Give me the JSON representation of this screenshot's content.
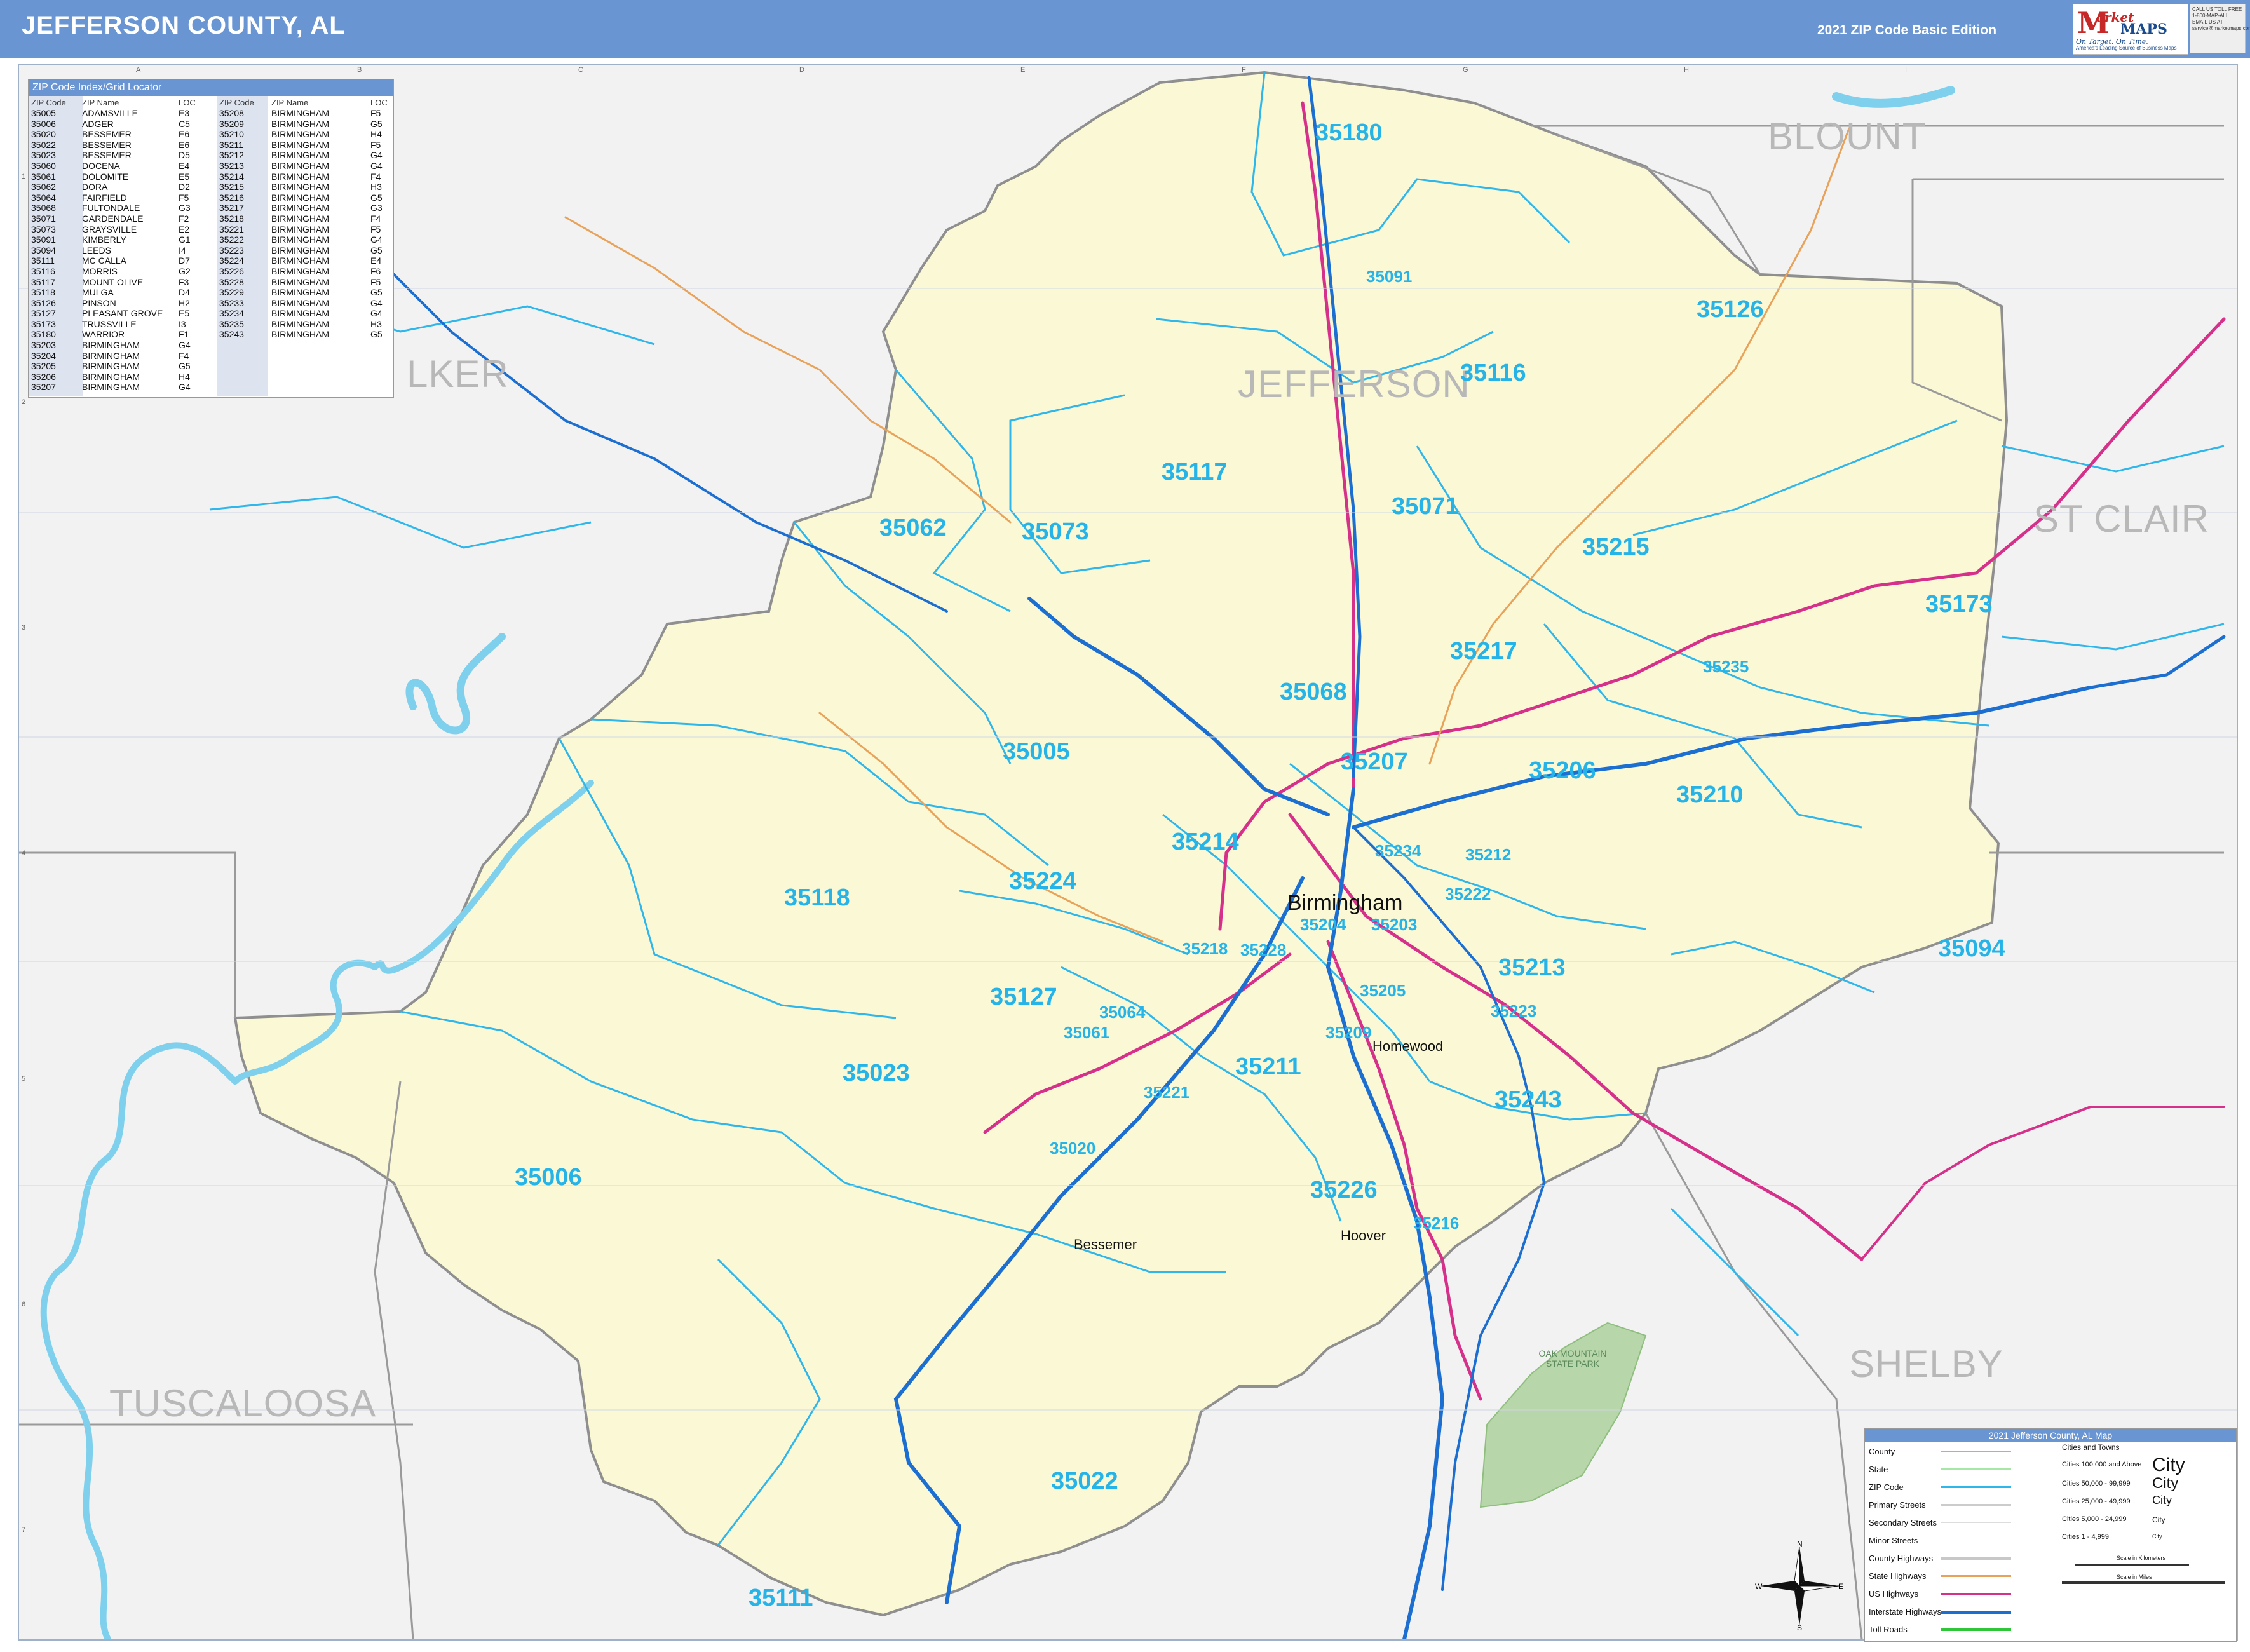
{
  "header": {
    "title": "JEFFERSON COUNTY, AL",
    "edition": "2021 ZIP Code Basic Edition",
    "logo": {
      "brand_letter": "M",
      "brand_top": "arket",
      "brand_bottom": "MAPS",
      "tagline": "On Target. On Time.",
      "tagline2": "America's Leading Source of Business Maps"
    },
    "contact_lines": [
      "CALL US TOLL FREE",
      "1-800-MAP-ALL",
      "EMAIL US AT",
      "service@marketmaps.com"
    ]
  },
  "grid": {
    "letters": [
      "A",
      "B",
      "C",
      "D",
      "E",
      "F",
      "G",
      "H",
      "I"
    ],
    "numbers": [
      "1",
      "2",
      "3",
      "4",
      "5",
      "6",
      "7"
    ]
  },
  "zip_index": {
    "title": "ZIP Code Index/Grid Locator",
    "headers": [
      "ZIP Code",
      "ZIP Name",
      "LOC",
      "ZIP Code",
      "ZIP Name",
      "LOC"
    ],
    "left": [
      [
        "35005",
        "ADAMSVILLE",
        "E3"
      ],
      [
        "35006",
        "ADGER",
        "C5"
      ],
      [
        "35020",
        "BESSEMER",
        "E6"
      ],
      [
        "35022",
        "BESSEMER",
        "E6"
      ],
      [
        "35023",
        "BESSEMER",
        "D5"
      ],
      [
        "35060",
        "DOCENA",
        "E4"
      ],
      [
        "35061",
        "DOLOMITE",
        "E5"
      ],
      [
        "35062",
        "DORA",
        "D2"
      ],
      [
        "35064",
        "FAIRFIELD",
        "F5"
      ],
      [
        "35068",
        "FULTONDALE",
        "G3"
      ],
      [
        "35071",
        "GARDENDALE",
        "F2"
      ],
      [
        "35073",
        "GRAYSVILLE",
        "E2"
      ],
      [
        "35091",
        "KIMBERLY",
        "G1"
      ],
      [
        "35094",
        "LEEDS",
        "I4"
      ],
      [
        "35111",
        "MC CALLA",
        "D7"
      ],
      [
        "35116",
        "MORRIS",
        "G2"
      ],
      [
        "35117",
        "MOUNT OLIVE",
        "F3"
      ],
      [
        "35118",
        "MULGA",
        "D4"
      ],
      [
        "35126",
        "PINSON",
        "H2"
      ],
      [
        "35127",
        "PLEASANT GROVE",
        "E5"
      ],
      [
        "35173",
        "TRUSSVILLE",
        "I3"
      ],
      [
        "35180",
        "WARRIOR",
        "F1"
      ],
      [
        "35203",
        "BIRMINGHAM",
        "G4"
      ],
      [
        "35204",
        "BIRMINGHAM",
        "F4"
      ],
      [
        "35205",
        "BIRMINGHAM",
        "G5"
      ],
      [
        "35206",
        "BIRMINGHAM",
        "H4"
      ],
      [
        "35207",
        "BIRMINGHAM",
        "G4"
      ]
    ],
    "right": [
      [
        "35208",
        "BIRMINGHAM",
        "F5"
      ],
      [
        "35209",
        "BIRMINGHAM",
        "G5"
      ],
      [
        "35210",
        "BIRMINGHAM",
        "H4"
      ],
      [
        "35211",
        "BIRMINGHAM",
        "F5"
      ],
      [
        "35212",
        "BIRMINGHAM",
        "G4"
      ],
      [
        "35213",
        "BIRMINGHAM",
        "G4"
      ],
      [
        "35214",
        "BIRMINGHAM",
        "F4"
      ],
      [
        "35215",
        "BIRMINGHAM",
        "H3"
      ],
      [
        "35216",
        "BIRMINGHAM",
        "G5"
      ],
      [
        "35217",
        "BIRMINGHAM",
        "G3"
      ],
      [
        "35218",
        "BIRMINGHAM",
        "F4"
      ],
      [
        "35221",
        "BIRMINGHAM",
        "F5"
      ],
      [
        "35222",
        "BIRMINGHAM",
        "G4"
      ],
      [
        "35223",
        "BIRMINGHAM",
        "G5"
      ],
      [
        "35224",
        "BIRMINGHAM",
        "E4"
      ],
      [
        "35226",
        "BIRMINGHAM",
        "F6"
      ],
      [
        "35228",
        "BIRMINGHAM",
        "F5"
      ],
      [
        "35229",
        "BIRMINGHAM",
        "G5"
      ],
      [
        "35233",
        "BIRMINGHAM",
        "G4"
      ],
      [
        "35234",
        "BIRMINGHAM",
        "G4"
      ],
      [
        "35235",
        "BIRMINGHAM",
        "H3"
      ],
      [
        "35243",
        "BIRMINGHAM",
        "G5"
      ]
    ]
  },
  "counties": {
    "blount": "BLOUNT",
    "walker": "LKER",
    "jefferson": "JEFFERSON",
    "st_clair": "ST CLAIR",
    "tuscaloosa": "TUSCALOOSA",
    "shelby": "SHELBY"
  },
  "zips": {
    "z35180": "35180",
    "z35091": "35091",
    "z35126": "35126",
    "z35116": "35116",
    "z35117": "35117",
    "z35071": "35071",
    "z35062": "35062",
    "z35073": "35073",
    "z35215": "35215",
    "z35173": "35173",
    "z35217": "35217",
    "z35235": "35235",
    "z35068": "35068",
    "z35005": "35005",
    "z35207": "35207",
    "z35206": "35206",
    "z35210": "35210",
    "z35214": "35214",
    "z35234": "35234",
    "z35212": "35212",
    "z35224": "35224",
    "z35118": "35118",
    "z35222": "35222",
    "z35203": "35203",
    "z35204": "35204",
    "z35094": "35094",
    "z35218": "35218",
    "z35228": "35228",
    "z35213": "35213",
    "z35127": "35127",
    "z35064": "35064",
    "z35205": "35205",
    "z35223": "35223",
    "z35209": "35209",
    "z35061": "35061",
    "z35023": "35023",
    "z35211": "35211",
    "z35243": "35243",
    "z35221": "35221",
    "z35020": "35020",
    "z35006": "35006",
    "z35226": "35226",
    "z35216": "35216",
    "z35022": "35022",
    "z35111": "35111"
  },
  "cities": {
    "birmingham": "Birmingham",
    "hoover": "Hoover",
    "homewood": "Homewood",
    "bessemer": "Bessemer"
  },
  "park": "OAK MOUNTAIN STATE PARK",
  "legend": {
    "title": "2021 Jefferson County, AL Map",
    "rows": [
      "County",
      "State",
      "ZIP Code",
      "Primary Streets",
      "Secondary Streets",
      "Minor Streets",
      "County Highways",
      "State Highways",
      "US Highways",
      "Interstate Highways",
      "Toll Roads"
    ],
    "cities_header": "Cities and Towns",
    "city_classes": [
      "Cities 100,000 and Above",
      "Cities 50,000 - 99,999",
      "Cities 25,000 - 49,999",
      "Cities 5,000 - 24,999",
      "Cities 1 - 4,999"
    ],
    "city_sample": "City",
    "scale_km": "Scale in Kilometers",
    "scale_mi": "Scale in Miles",
    "colors": {
      "county": "#b0b0b0",
      "state": "#a6e7a6",
      "zip": "#2fb6ea",
      "primary": "#cccccc",
      "secondary": "#dddddd",
      "minor": "#eeeeee",
      "county_hwy": "#c8c8c8",
      "state_hwy": "#e8a25a",
      "us_hwy": "#d6318a",
      "interstate": "#1c6fd1",
      "toll": "#2fc63a"
    }
  },
  "compass": {
    "n": "N",
    "s": "S",
    "e": "E",
    "w": "W"
  }
}
